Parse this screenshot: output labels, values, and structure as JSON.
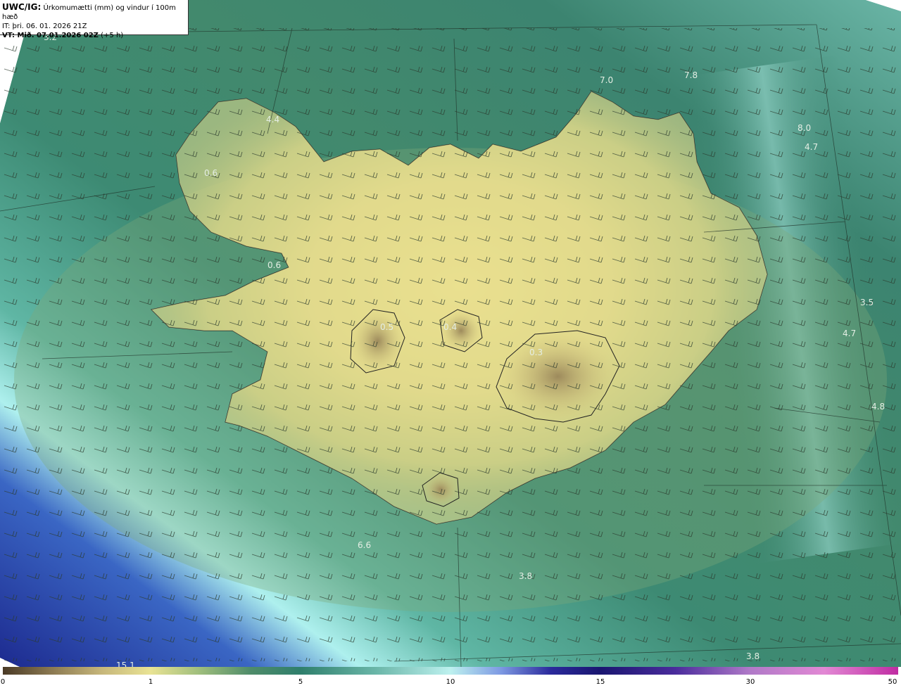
{
  "header": {
    "product_label": "UWC/IG:",
    "product_title": "Úrkomumætti (mm) og vindur í 100m hæð",
    "init_time": "IT: þri. 06. 01. 2026 21Z",
    "valid_label": "VT: Mið. 07.01.2026 02Z",
    "lead_time": "(+5 h)"
  },
  "map": {
    "value_labels": [
      {
        "text": "3.2"
      },
      {
        "text": "4.4"
      },
      {
        "text": "7.0"
      },
      {
        "text": "7.8"
      },
      {
        "text": "8.0"
      },
      {
        "text": "4.7"
      },
      {
        "text": "0.6"
      },
      {
        "text": "0.6"
      },
      {
        "text": "0.5"
      },
      {
        "text": "0.4"
      },
      {
        "text": "0.3"
      },
      {
        "text": "3.5"
      },
      {
        "text": "4.7"
      },
      {
        "text": "4.8"
      },
      {
        "text": "6.6"
      },
      {
        "text": "3.8"
      },
      {
        "text": "3.8"
      },
      {
        "text": "15.1"
      }
    ],
    "colors": {
      "land_low": "#e8df8c",
      "coast_mid": "#7fa373",
      "ocean": "#2f7f6a",
      "deep": "#2a1a8f",
      "cyan": "#b0f0ee"
    }
  },
  "colorbar": {
    "ticks": [
      "0",
      "1",
      "5",
      "10",
      "15",
      "30",
      "50"
    ]
  }
}
